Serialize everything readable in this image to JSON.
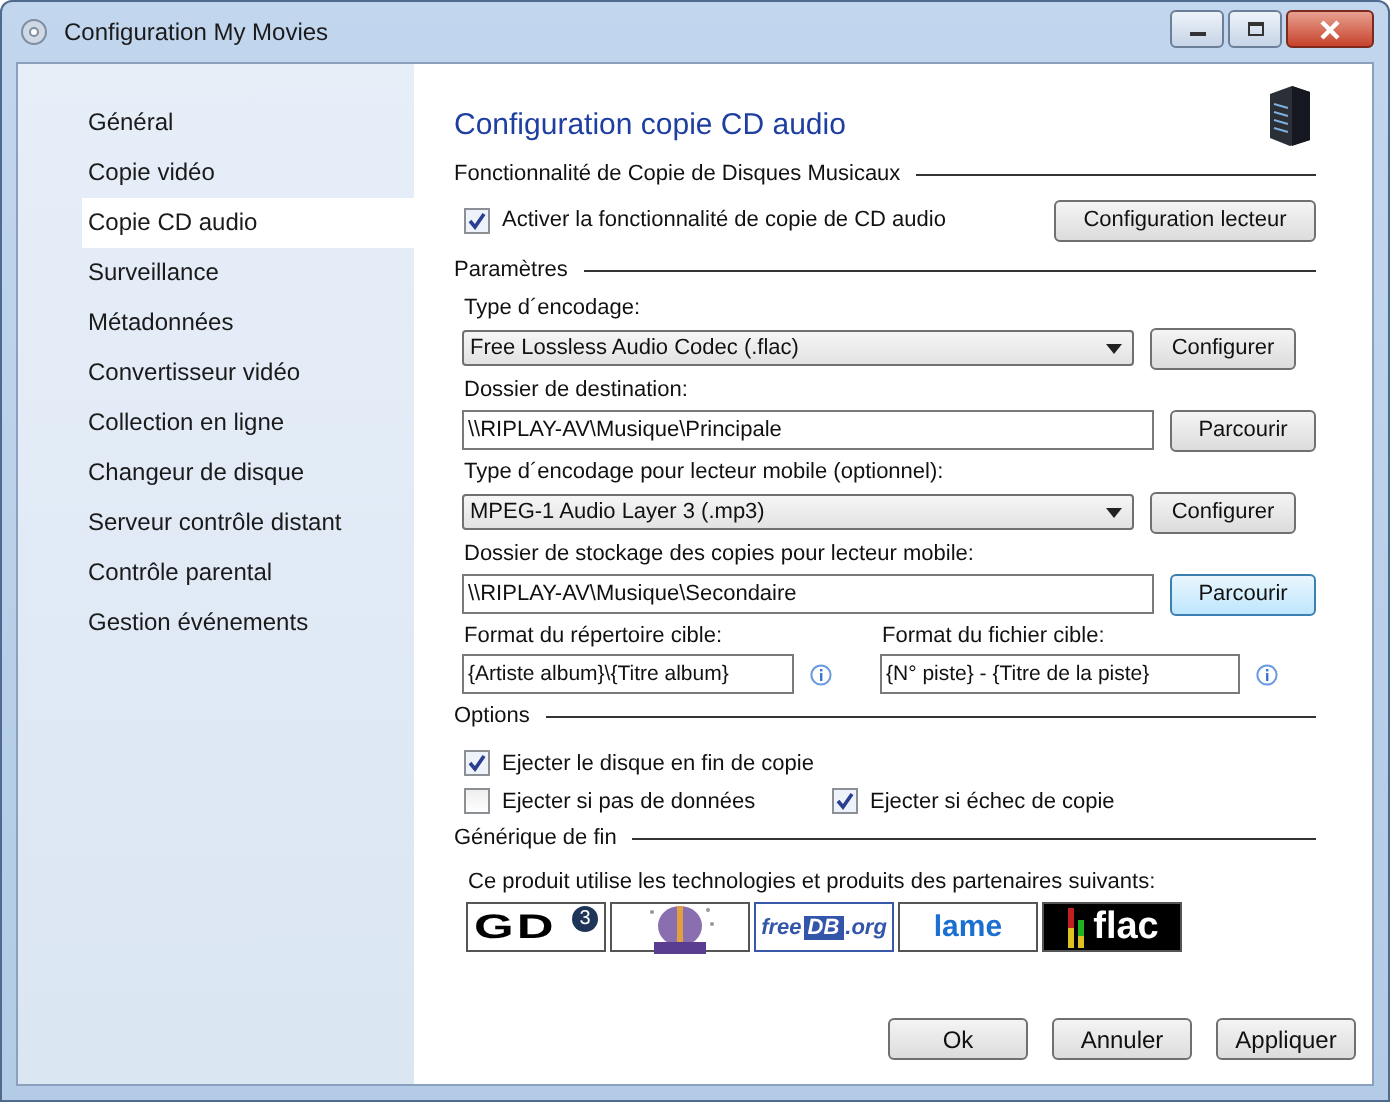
{
  "window": {
    "title": "Configuration My Movies"
  },
  "sidebar": {
    "items": [
      {
        "label": "Général",
        "selected": false
      },
      {
        "label": "Copie vidéo",
        "selected": false
      },
      {
        "label": "Copie CD audio",
        "selected": true
      },
      {
        "label": "Surveillance",
        "selected": false
      },
      {
        "label": "Métadonnées",
        "selected": false
      },
      {
        "label": "Convertisseur vidéo",
        "selected": false
      },
      {
        "label": "Collection en ligne",
        "selected": false
      },
      {
        "label": "Changeur de disque",
        "selected": false
      },
      {
        "label": "Serveur contrôle distant",
        "selected": false
      },
      {
        "label": "Contrôle parental",
        "selected": false
      },
      {
        "label": "Gestion événements",
        "selected": false
      }
    ]
  },
  "page": {
    "title": "Configuration copie CD audio"
  },
  "feature": {
    "heading": "Fonctionnalité de Copie de Disques Musicaux",
    "checkbox": {
      "label": "Activer la fonctionnalité de copie de CD audio",
      "checked": true
    },
    "button": "Configuration lecteur"
  },
  "parameters": {
    "heading": "Paramètres",
    "rows": [
      {
        "kind": "dropdown",
        "label": "Type d´encodage:",
        "value": "Free Lossless Audio Codec (.flac)",
        "button": "Configurer",
        "focused": false
      },
      {
        "kind": "path",
        "label": "Dossier de destination:",
        "value": "\\\\RIPLAY-AV\\Musique\\Principale",
        "button": "Parcourir",
        "focused": false
      },
      {
        "kind": "dropdown",
        "label": "Type d´encodage pour lecteur mobile (optionnel):",
        "value": "MPEG-1 Audio Layer 3 (.mp3)",
        "button": "Configurer",
        "focused": false
      },
      {
        "kind": "path",
        "label": "Dossier de stockage des copies pour lecteur mobile:",
        "value": "\\\\RIPLAY-AV\\Musique\\Secondaire",
        "button": "Parcourir",
        "focused": true
      }
    ],
    "formats": [
      {
        "label": "Format du répertoire cible:",
        "value": "{Artiste album}\\{Titre album}"
      },
      {
        "label": "Format du fichier cible:",
        "value": "{N° piste} - {Titre de la piste}"
      }
    ]
  },
  "options": {
    "heading": "Options",
    "rows": [
      [
        {
          "label": "Ejecter le disque en fin de copie",
          "checked": true
        }
      ],
      [
        {
          "label": "Ejecter si pas de données",
          "checked": false
        },
        {
          "label": "Ejecter si échec de copie",
          "checked": true
        }
      ]
    ]
  },
  "credits": {
    "heading": "Générique de fin",
    "text": "Ce produit utilise les technologies et produits des partenaires suivants:",
    "logos": [
      {
        "kind": "gd",
        "text": "GD",
        "badge": "3"
      },
      {
        "kind": "musicbrainz"
      },
      {
        "kind": "freedb",
        "parts": [
          "free",
          "DB",
          ".org"
        ]
      },
      {
        "kind": "lame",
        "text": "lame"
      },
      {
        "kind": "flac",
        "text": "flac"
      }
    ]
  },
  "buttons": [
    "Ok",
    "Annuler",
    "Appliquer"
  ]
}
